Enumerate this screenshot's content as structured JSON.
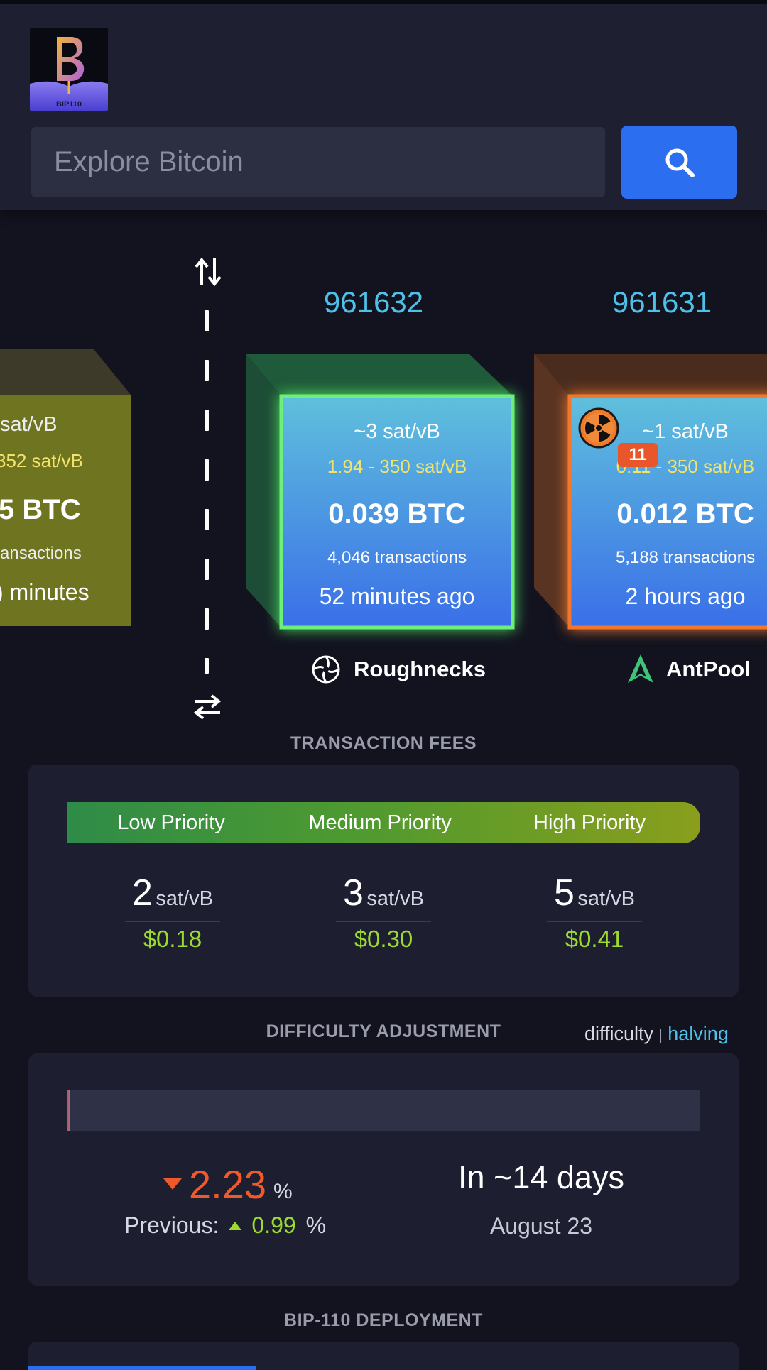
{
  "header": {
    "logo_text": "BIP110",
    "search": {
      "placeholder": "Explore Bitcoin"
    }
  },
  "blocks": [
    {
      "height": "",
      "fee_median": "sat/vB",
      "fee_range": "352 sat/vB",
      "total": "5 BTC",
      "tx_count": "ansactions",
      "time": ") minutes",
      "pool": ""
    },
    {
      "height": "961632",
      "fee_median": "~3 sat/vB",
      "fee_range": "1.94 - 350 sat/vB",
      "total": "0.039 BTC",
      "tx_count": "4,046 transactions",
      "time": "52 minutes ago",
      "pool": "Roughnecks"
    },
    {
      "height": "961631",
      "fee_median": "~1 sat/vB",
      "fee_range": "0.11 - 350 sat/vB",
      "total": "0.012 BTC",
      "tx_count": "5,188 transactions",
      "time": "2 hours ago",
      "pool": "AntPool",
      "badge": "11"
    }
  ],
  "fees": {
    "title": "TRANSACTION FEES",
    "priorities": [
      {
        "label": "Low Priority",
        "value": "2",
        "unit": "sat/vB",
        "usd": "$0.18"
      },
      {
        "label": "Medium Priority",
        "value": "3",
        "unit": "sat/vB",
        "usd": "$0.30"
      },
      {
        "label": "High Priority",
        "value": "5",
        "unit": "sat/vB",
        "usd": "$0.41"
      }
    ]
  },
  "difficulty": {
    "title": "DIFFICULTY ADJUSTMENT",
    "tab_difficulty": "difficulty",
    "tab_separator": "|",
    "tab_halving": "halving",
    "progress_fraction": 0.004,
    "change": "2.23",
    "change_unit": "%",
    "previous_label": "Previous:",
    "previous_value": "0.99",
    "previous_unit": "%",
    "eta": "In ~14 days",
    "date": "August 23"
  },
  "bip110": {
    "title": "BIP-110 DEPLOYMENT"
  },
  "colors": {
    "accent": "#2b6ff0",
    "height": "#4fc1e9",
    "fee_range": "#f2e36b",
    "usd": "#9cdb2d",
    "decrease": "#f05a2b"
  }
}
